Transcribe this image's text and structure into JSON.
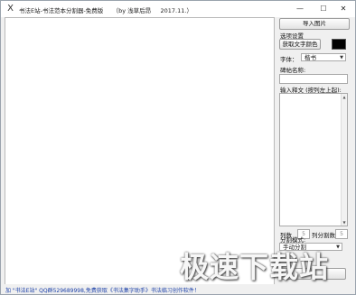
{
  "window": {
    "title": "书法E站-书法范本分割器-免费版     （by 浅草后昂     2017.11.）",
    "min_glyph": "—",
    "max_glyph": "☐",
    "close_glyph": "✕",
    "icon_glyph": "X"
  },
  "sidebar": {
    "import_button": "导入图片",
    "section_options": "选项设置",
    "color_button": "获取文字颜色",
    "swatch_color": "#000000",
    "font_label": "字体：",
    "font_value": "楷书",
    "inscription_label": "碑帖名称:",
    "inscription_value": "",
    "text_label": "输入释文 (按列左上起):",
    "text_value": "",
    "cols_label": "列数",
    "cols_value": "5",
    "col_chars_label": "列分割数",
    "col_chars_value": "5",
    "split_mode_label": "分割模式:",
    "split_mode_value": "手动分割"
  },
  "status": {
    "text": "加 \"书法E站\" QQ群529689998,免费获取《书法集字助手》书法临习创作软件！"
  },
  "watermark": {
    "text": "极速下载站"
  }
}
